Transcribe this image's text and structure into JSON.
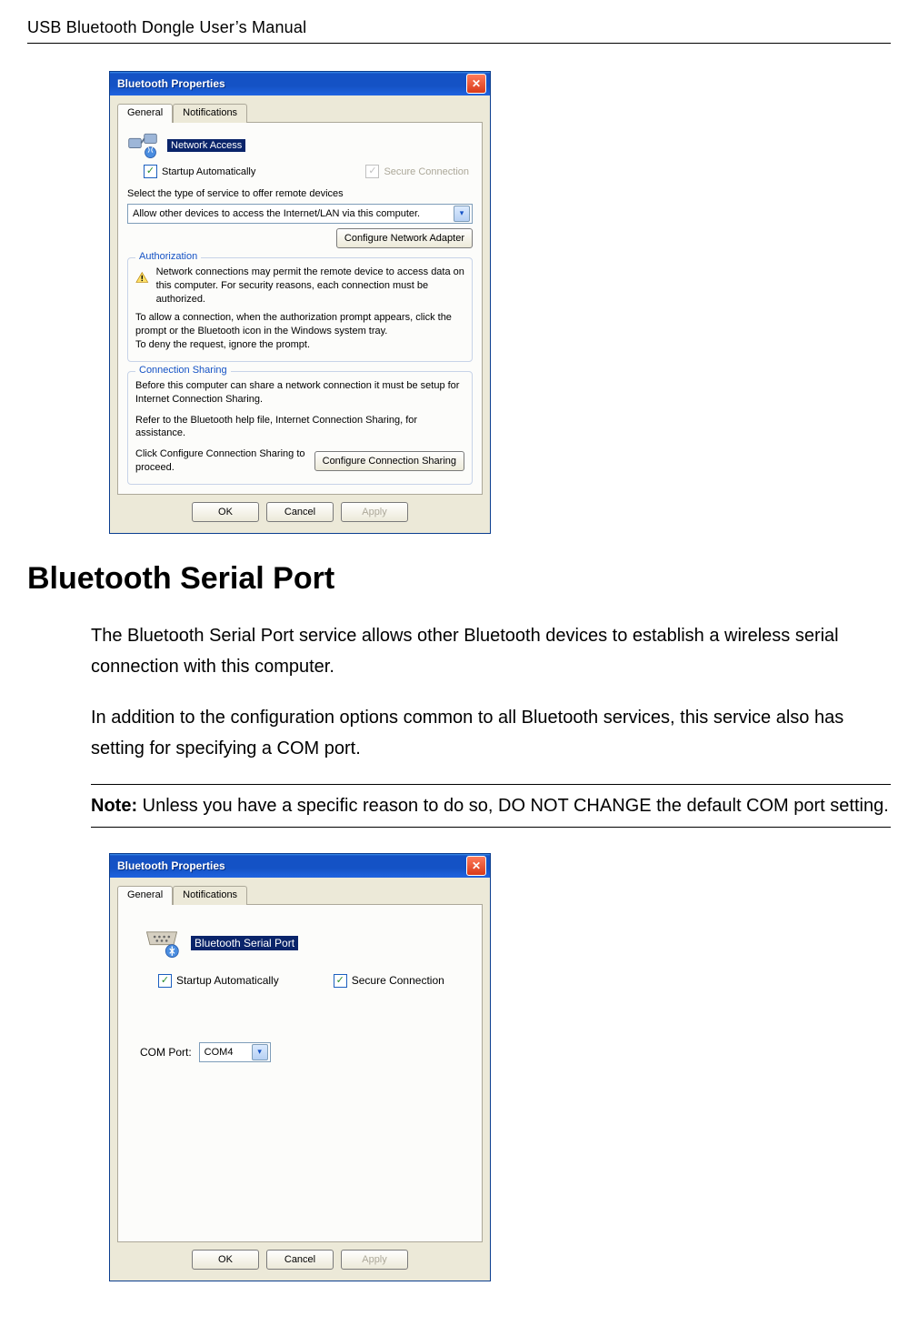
{
  "header": "USB Bluetooth Dongle User’s Manual",
  "section_title": "Bluetooth Serial Port",
  "para1": "The Bluetooth Serial Port service allows other Bluetooth devices to establish a wireless serial connection with this computer.",
  "para2": "In addition to the configuration options common to all Bluetooth services, this service also has setting for specifying a COM port.",
  "note_bold": "Note:",
  "note_text": " Unless you have a specific reason to do so, DO NOT CHANGE the default COM port setting.",
  "dlg1": {
    "title": "Bluetooth Properties",
    "tab_general": "General",
    "tab_notifications": "Notifications",
    "service_name": "Network Access",
    "startup": "Startup Automatically",
    "secure": "Secure Connection",
    "select_label": "Select the type of service to offer remote devices",
    "select_value": "Allow other devices to access the Internet/LAN via this computer.",
    "config_adapter_btn": "Configure Network Adapter",
    "auth_title": "Authorization",
    "auth_l1": "Network connections may permit the remote device to access data on this computer. For security reasons, each connection must be authorized.",
    "auth_l2": "To allow a connection, when the authorization prompt appears, click the prompt or the Bluetooth icon in the Windows system tray.",
    "auth_l3": "To deny the request, ignore the prompt.",
    "share_title": "Connection Sharing",
    "share_l1": "Before this computer can share a network connection it must be setup for Internet Connection Sharing.",
    "share_l2": "Refer to the Bluetooth help file, Internet Connection Sharing, for assistance.",
    "share_l3": "Click Configure Connection Sharing to proceed.",
    "config_sharing_btn": "Configure Connection Sharing",
    "ok": "OK",
    "cancel": "Cancel",
    "apply": "Apply"
  },
  "dlg2": {
    "title": "Bluetooth Properties",
    "tab_general": "General",
    "tab_notifications": "Notifications",
    "service_name": "Bluetooth Serial Port",
    "startup": "Startup Automatically",
    "secure": "Secure Connection",
    "com_label": "COM Port:",
    "com_value": "COM4",
    "ok": "OK",
    "cancel": "Cancel",
    "apply": "Apply"
  }
}
